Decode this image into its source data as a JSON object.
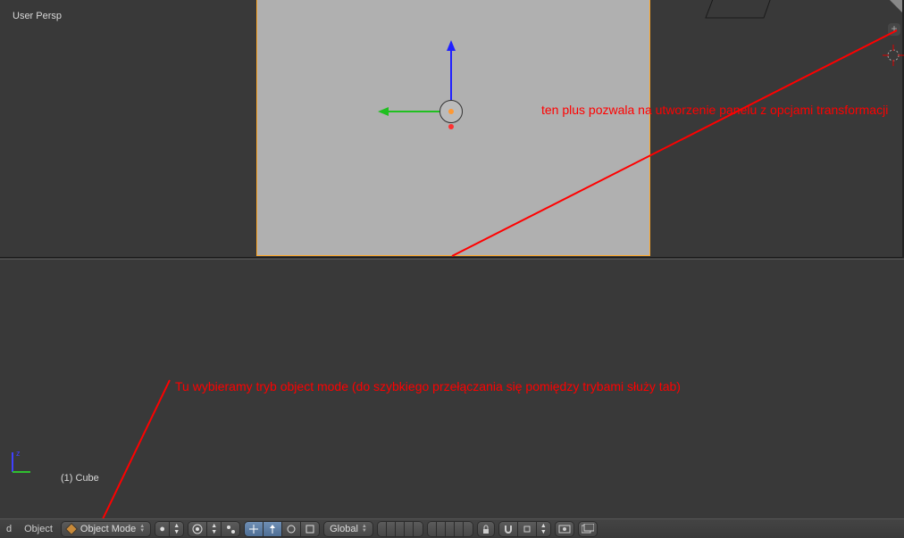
{
  "viewport": {
    "persp_label": "User Persp",
    "object_label": "(1) Cube"
  },
  "annotations": {
    "right": "ten plus pozwala na utworzenie panelu z opcjami transformacji",
    "left": "Tu wybieramy tryb object mode (do szybkiego przełączania się pomiędzy trybami służy tab)"
  },
  "header": {
    "menu_d": "d",
    "menu_object": "Object",
    "mode_label": "Object Mode",
    "orientation_label": "Global",
    "plus_symbol": "+"
  },
  "icons": {
    "shading_solid": "●",
    "pivot_updn": "▲▼"
  }
}
